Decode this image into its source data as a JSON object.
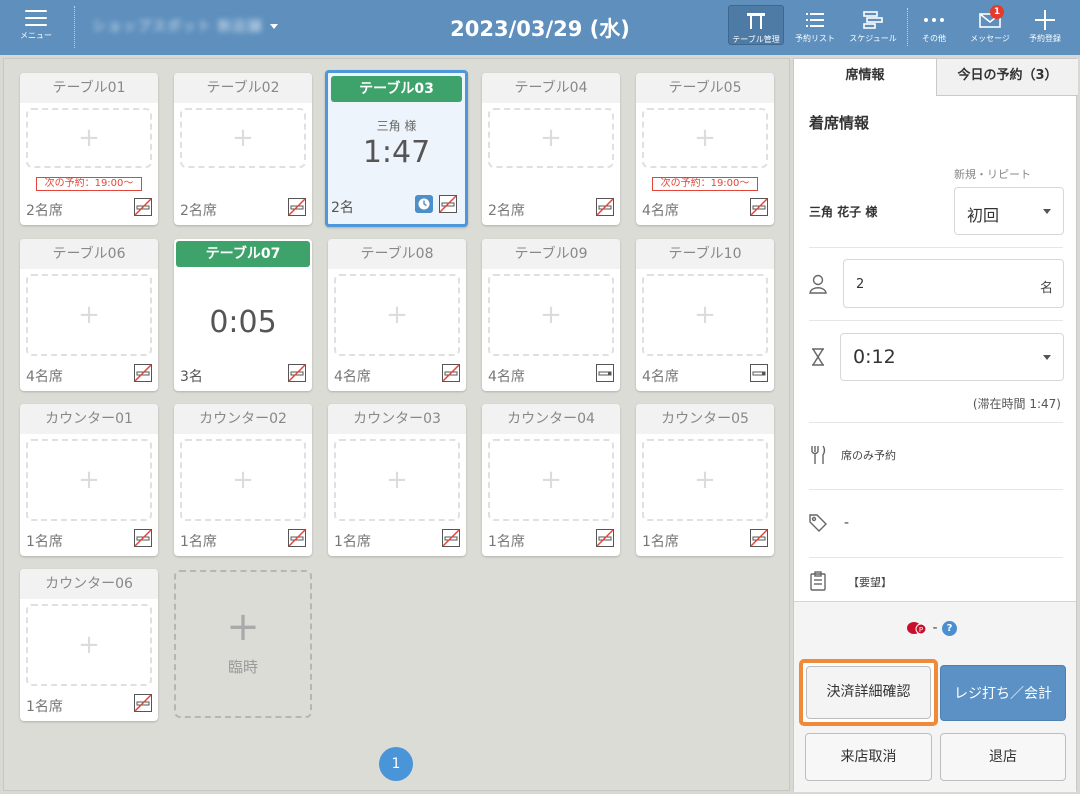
{
  "header": {
    "menu_label": "メニュー",
    "store_name": "ショップスポット 新店舗",
    "date": "2023/03/29 (水)",
    "tools": [
      {
        "label": "テーブル管理",
        "icon": "table-manage-icon"
      },
      {
        "label": "予約リスト",
        "icon": "list-icon"
      },
      {
        "label": "スケジュール",
        "icon": "schedule-icon"
      },
      {
        "label": "その他",
        "icon": "more-icon"
      },
      {
        "label": "メッセージ",
        "icon": "mail-icon",
        "badge": "1"
      },
      {
        "label": "予約登録",
        "icon": "plus-icon"
      }
    ]
  },
  "tables": [
    {
      "name": "テーブル01",
      "seats": "2名席",
      "next": "次の予約：19:00〜",
      "smoke": "no-smoking-icon"
    },
    {
      "name": "テーブル02",
      "seats": "2名席",
      "smoke": "no-smoking-icon"
    },
    {
      "name": "テーブル03",
      "seats": "2名",
      "guest": "三角 様",
      "timer": "1:47",
      "smoke": "no-smoking-icon"
    },
    {
      "name": "テーブル04",
      "seats": "2名席",
      "smoke": "no-smoking-icon"
    },
    {
      "name": "テーブル05",
      "seats": "4名席",
      "next": "次の予約：19:00〜",
      "smoke": "no-smoking-icon"
    },
    {
      "name": "テーブル06",
      "seats": "4名席",
      "smoke": "no-smoking-icon"
    },
    {
      "name": "テーブル07",
      "seats": "3名",
      "timer": "0:05",
      "smoke": "no-smoking-icon"
    },
    {
      "name": "テーブル08",
      "seats": "4名席",
      "smoke": "no-smoking-icon"
    },
    {
      "name": "テーブル09",
      "seats": "4名席",
      "smoke": "smoking-icon"
    },
    {
      "name": "テーブル10",
      "seats": "4名席",
      "smoke": "smoking-icon"
    },
    {
      "name": "カウンター01",
      "seats": "1名席",
      "smoke": "no-smoking-icon"
    },
    {
      "name": "カウンター02",
      "seats": "1名席",
      "smoke": "no-smoking-icon"
    },
    {
      "name": "カウンター03",
      "seats": "1名席",
      "smoke": "no-smoking-icon"
    },
    {
      "name": "カウンター04",
      "seats": "1名席",
      "smoke": "no-smoking-icon"
    },
    {
      "name": "カウンター05",
      "seats": "1名席",
      "smoke": "no-smoking-icon"
    },
    {
      "name": "カウンター06",
      "seats": "1名席",
      "smoke": "no-smoking-icon"
    }
  ],
  "temp": {
    "plus": "+",
    "label": "臨時"
  },
  "slot_plus": "+",
  "page": "1",
  "panel": {
    "tab_seat": "席情報",
    "tab_today": "今日の予約（3）",
    "title": "着席情報",
    "repeat_label": "新規・リピート",
    "guest_name": "三角 花子 様",
    "repeat_value": "初回",
    "people_value": "2",
    "people_unit": "名",
    "time_value": "0:12",
    "stay": "(滞在時間 1:47)",
    "seat_only": "席のみ予約",
    "tag_value": "-",
    "request": "【要望】",
    "points_value": "-",
    "help": "?",
    "btn_confirm": "決済詳細確認",
    "btn_register": "レジ打ち／会計",
    "btn_cancel": "来店取消",
    "btn_exit": "退店"
  },
  "colors": {
    "header": "#5e8fbd",
    "busy": "#3ea36b",
    "selected_border": "#4f97db",
    "alert": "#e2463a",
    "highlight": "#ee8a3a",
    "primary_button": "#5b91c5"
  }
}
